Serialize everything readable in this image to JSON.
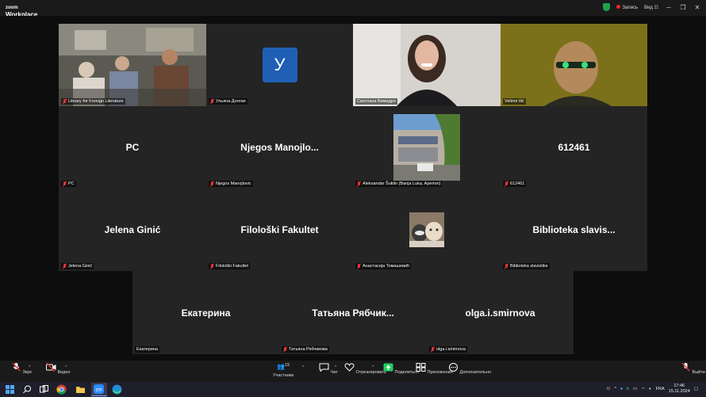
{
  "app": {
    "logo_line1": "zoom",
    "logo_line2": "Workplace",
    "recording_label": "Запись",
    "view_label": "Вид",
    "accent": "#23d160"
  },
  "participants": [
    {
      "id": "library",
      "name": "Library for Foreign Literature",
      "display": "",
      "kind": "video"
    },
    {
      "id": "ulyana",
      "name": "Ульяна Долгая",
      "display": "У",
      "kind": "avatar"
    },
    {
      "id": "svetlana",
      "name": "Светлана Вимодро",
      "display": "",
      "kind": "video",
      "active": true
    },
    {
      "id": "velimir",
      "name": "Velimir Ilić",
      "display": "",
      "kind": "video"
    },
    {
      "id": "pc",
      "name": "PC",
      "display": "PC",
      "kind": "name"
    },
    {
      "id": "njegos",
      "name": "Njegos Manojlovic",
      "display": "Njegos  Manojlo...",
      "kind": "name"
    },
    {
      "id": "aleksandar",
      "name": "Aleksandar Šuklin (Banja Luka, Apeiron)",
      "display": "",
      "kind": "picture"
    },
    {
      "id": "n612461",
      "name": "612461",
      "display": "612461",
      "kind": "name"
    },
    {
      "id": "jelena",
      "name": "Jelena Ginić",
      "display": "Jelena Ginić",
      "kind": "name"
    },
    {
      "id": "filoloski",
      "name": "Filološki Fakultet",
      "display": "Filološki Fakultet",
      "kind": "name"
    },
    {
      "id": "anastasia",
      "name": "Анастасија Томашевић",
      "display": "",
      "kind": "picture"
    },
    {
      "id": "biblioteka",
      "name": "Biblioteka slavistike",
      "display": "Biblioteka  slavis...",
      "kind": "name"
    },
    {
      "id": "ekaterina",
      "name": "Екатерина",
      "display": "Екатерина",
      "kind": "name"
    },
    {
      "id": "tatyana",
      "name": "Татьяна Рябчикова",
      "display": "Татьяна  Рябчик...",
      "kind": "name"
    },
    {
      "id": "olga",
      "name": "olga.i.smirnova",
      "display": "olga.i.smirnova",
      "kind": "name"
    }
  ],
  "toolbar": {
    "audio": "Звук",
    "video": "Видео",
    "participants": "Участники",
    "participants_count": "15",
    "chat": "Чат",
    "react": "Отреагировать",
    "share": "Поделиться",
    "apps": "Приложения",
    "more": "Дополнительно",
    "leave": "Выйти"
  },
  "taskbar": {
    "lang": "FRA",
    "time": "17:46",
    "date": "15.11.2024"
  }
}
